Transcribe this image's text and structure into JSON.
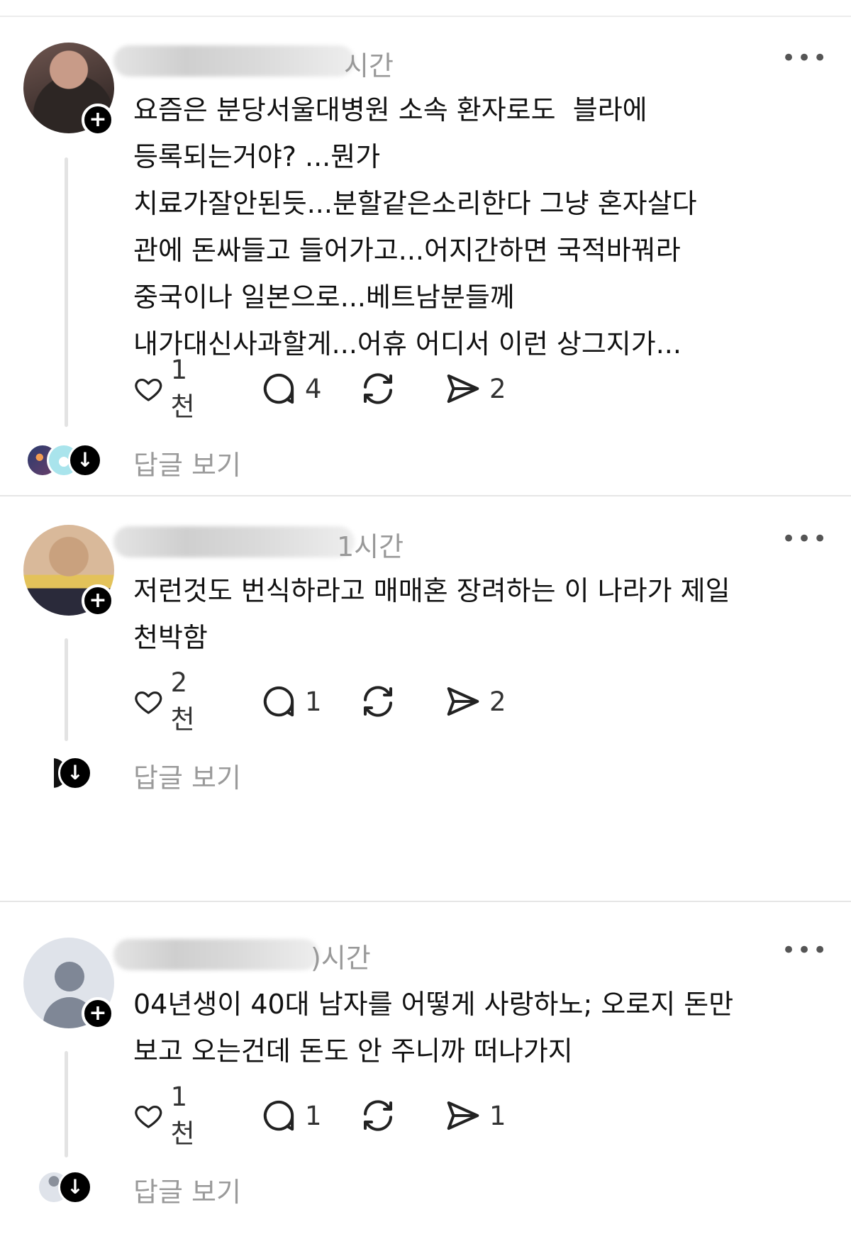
{
  "posts": [
    {
      "time": "시간",
      "text_lines": [
        "요즘은 분당서울대병원 소속 환자로도  블라에",
        "등록되는거야? ...뭔가",
        "치료가잘안된듯...분할같은소리한다 그냥 혼자살다",
        "관에 돈싸들고 들어가고...어지간하면 국적바꿔라",
        "중국이나 일본으로...베트남분들께",
        "내가대신사과할게...어휴 어디서 이런 상그지가..."
      ],
      "likes": "1천",
      "comments": "4",
      "shares": "2",
      "view_replies": "답글 보기"
    },
    {
      "time": "1시간",
      "text_lines": [
        "저런것도 번식하라고 매매혼 장려하는 이 나라가 제일",
        "천박함"
      ],
      "likes": "2천",
      "comments": "1",
      "shares": "2",
      "view_replies": "답글 보기"
    },
    {
      "time": ")시간",
      "text_lines": [
        "04년생이 40대 남자를 어떻게 사랑하노; 오로지 돈만",
        "보고 오는건데 돈도 안 주니까 떠나가지"
      ],
      "likes": "1천",
      "comments": "1",
      "shares": "1",
      "view_replies": "답글 보기"
    }
  ],
  "icons": {
    "more": "more-horizontal-icon",
    "like": "heart-icon",
    "comment": "comment-bubble-icon",
    "repost": "repost-icon",
    "share": "send-icon",
    "follow": "plus-icon",
    "expand": "arrow-down-icon"
  },
  "colors": {
    "text": "#111111",
    "secondary": "#999999",
    "badge": "#000000",
    "divider": "#e6e6e6"
  }
}
